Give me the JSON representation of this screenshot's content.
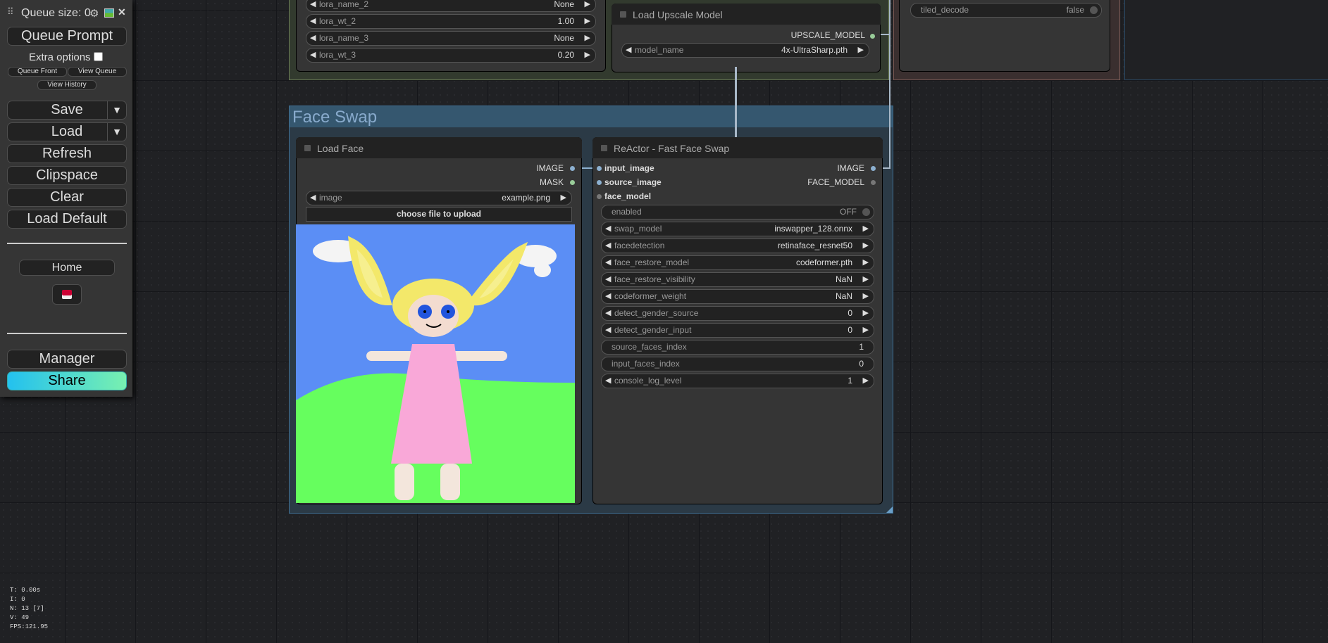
{
  "menu": {
    "queue_size_label": "Queue size: 0",
    "queue_prompt": "Queue Prompt",
    "extra_options": "Extra options",
    "queue_front": "Queue Front",
    "view_queue": "View Queue",
    "view_history": "View History",
    "save": "Save",
    "load": "Load",
    "refresh": "Refresh",
    "clipspace": "Clipspace",
    "clear": "Clear",
    "load_default": "Load Default",
    "home": "Home",
    "manager": "Manager",
    "share": "Share",
    "dropdown_arrow": "▼",
    "close": "✕"
  },
  "lora_node": {
    "widgets": [
      {
        "label": "lora_name_2",
        "value": "None"
      },
      {
        "label": "lora_wt_2",
        "value": "1.00"
      },
      {
        "label": "lora_name_3",
        "value": "None"
      },
      {
        "label": "lora_wt_3",
        "value": "0.20"
      }
    ]
  },
  "upscale_node": {
    "title": "Load Upscale Model",
    "output": "UPSCALE_MODEL",
    "widget_label": "model_name",
    "widget_value": "4x-UltraSharp.pth"
  },
  "decode_node": {
    "widget_label": "tiled_decode",
    "widget_value": "false"
  },
  "group": {
    "title": "Face Swap"
  },
  "load_face_node": {
    "title": "Load Face",
    "outputs": [
      "IMAGE",
      "MASK"
    ],
    "image_label": "image",
    "image_value": "example.png",
    "upload_button": "choose file to upload"
  },
  "reactor_node": {
    "title": "ReActor - Fast Face Swap",
    "inputs": [
      "input_image",
      "source_image",
      "face_model"
    ],
    "outputs": [
      "IMAGE",
      "FACE_MODEL"
    ],
    "toggle": {
      "label": "enabled",
      "value": "OFF"
    },
    "widgets": [
      {
        "label": "swap_model",
        "value": "inswapper_128.onnx",
        "arrows": true
      },
      {
        "label": "facedetection",
        "value": "retinaface_resnet50",
        "arrows": true
      },
      {
        "label": "face_restore_model",
        "value": "codeformer.pth",
        "arrows": true
      },
      {
        "label": "face_restore_visibility",
        "value": "NaN",
        "arrows": true
      },
      {
        "label": "codeformer_weight",
        "value": "NaN",
        "arrows": true
      },
      {
        "label": "detect_gender_source",
        "value": "0",
        "arrows": true
      },
      {
        "label": "detect_gender_input",
        "value": "0",
        "arrows": true
      },
      {
        "label": "source_faces_index",
        "value": "1",
        "arrows": false
      },
      {
        "label": "input_faces_index",
        "value": "0",
        "arrows": false
      },
      {
        "label": "console_log_level",
        "value": "1",
        "arrows": true
      }
    ]
  },
  "stats": [
    "T: 0.00s",
    "I: 0",
    "N: 13 [7]",
    "V: 49",
    "FPS:121.95"
  ],
  "arrows": {
    "left": "◀",
    "right": "▶"
  }
}
